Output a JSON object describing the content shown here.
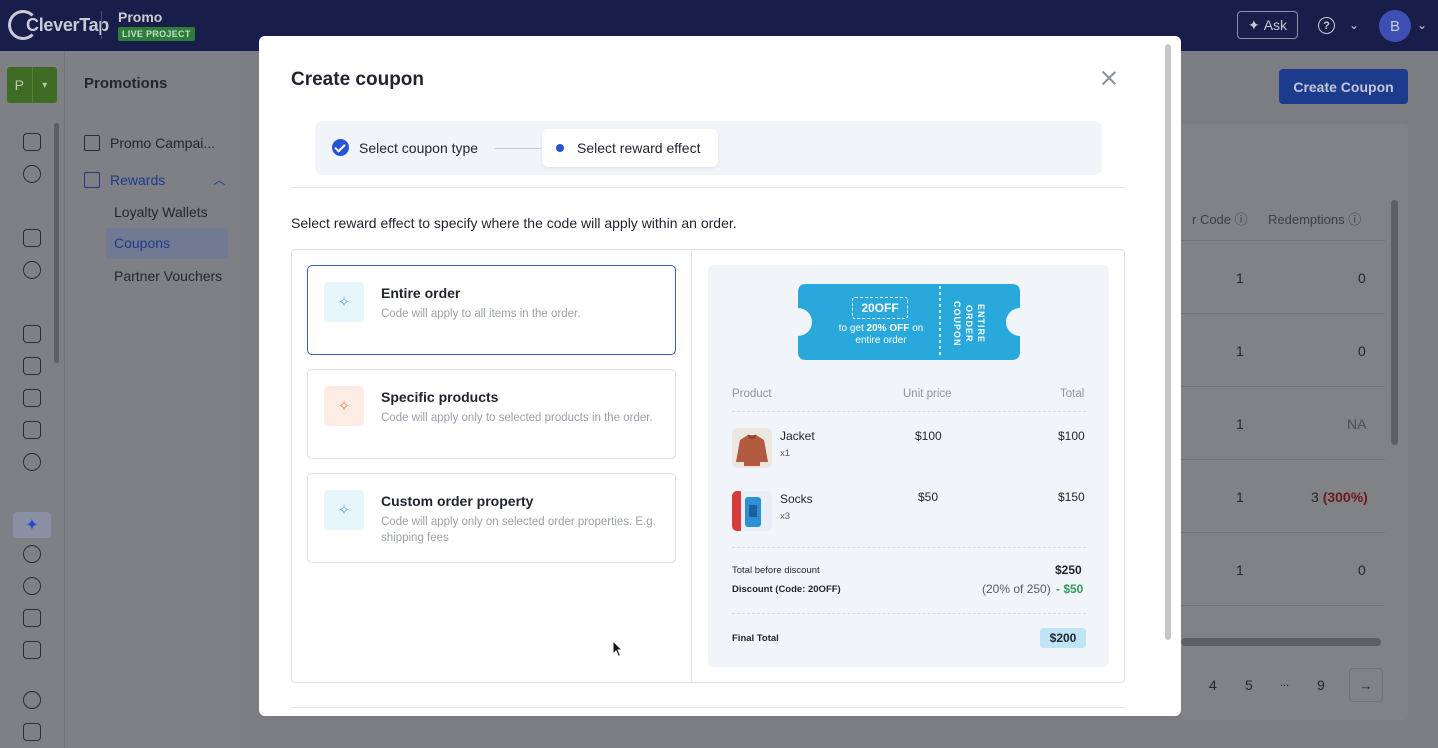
{
  "app": {
    "logo_text": "CleverTap",
    "project_name": "Promo",
    "project_badge": "LIVE PROJECT",
    "ask_label": "Ask",
    "avatar_initial": "B",
    "project_switch": "P"
  },
  "subnav": {
    "title": "Promotions",
    "items": [
      {
        "label": "Promo Campai..."
      },
      {
        "label": "Rewards"
      }
    ],
    "sub_items": [
      {
        "label": "Loyalty Wallets"
      },
      {
        "label": "Coupons"
      },
      {
        "label": "Partner Vouchers"
      }
    ]
  },
  "main": {
    "create_button": "Create Coupon",
    "columns": [
      "r Code",
      "Redemptions"
    ],
    "rows": [
      {
        "code": "1",
        "redemptions": "0"
      },
      {
        "code": "1",
        "redemptions": "0"
      },
      {
        "code": "1",
        "redemptions": "NA"
      },
      {
        "code": "1",
        "redemptions": "3",
        "redemptions_pct": "(300%)"
      },
      {
        "code": "1",
        "redemptions": "0"
      }
    ],
    "pagination": [
      "4",
      "5",
      "...",
      "9"
    ],
    "next_arrow": "→"
  },
  "modal": {
    "title": "Create coupon",
    "steps": [
      {
        "label": "Select coupon type",
        "state": "done"
      },
      {
        "label": "Select reward effect",
        "state": "active"
      }
    ],
    "instruction": "Select reward effect to specify where the code will apply within an order.",
    "options": [
      {
        "title": "Entire order",
        "desc": "Code will apply to all items in the order.",
        "icon": "sparkle-icon",
        "selected": true
      },
      {
        "title": "Specific products",
        "desc": "Code will apply only to selected products in the order.",
        "icon": "sparkle-icon"
      },
      {
        "title": "Custom order property",
        "desc": "Code will apply only on selected order properties. E.g. shipping fees",
        "icon": "sparkle-icon"
      }
    ],
    "preview": {
      "coupon_code": "20OFF",
      "coupon_desc_prefix": "to get ",
      "coupon_desc_bold": "20% OFF",
      "coupon_desc_suffix": " on entire order",
      "coupon_side": "ENTIRE ORDER COUPON",
      "coupon_color": "#29a8dc",
      "headers": {
        "product": "Product",
        "unit_price": "Unit price",
        "total": "Total"
      },
      "products": [
        {
          "name": "Jacket",
          "qty": "x1",
          "unit_price": "$100",
          "total": "$100"
        },
        {
          "name": "Socks",
          "qty": "x3",
          "unit_price": "$50",
          "total": "$150"
        }
      ],
      "total_before_label": "Total before discount",
      "total_before_value": "$250",
      "discount_label": "Discount (Code: 20OFF)",
      "discount_note": "(20% of 250)",
      "discount_value": "- $50",
      "final_label": "Final Total",
      "final_value": "$200"
    }
  }
}
